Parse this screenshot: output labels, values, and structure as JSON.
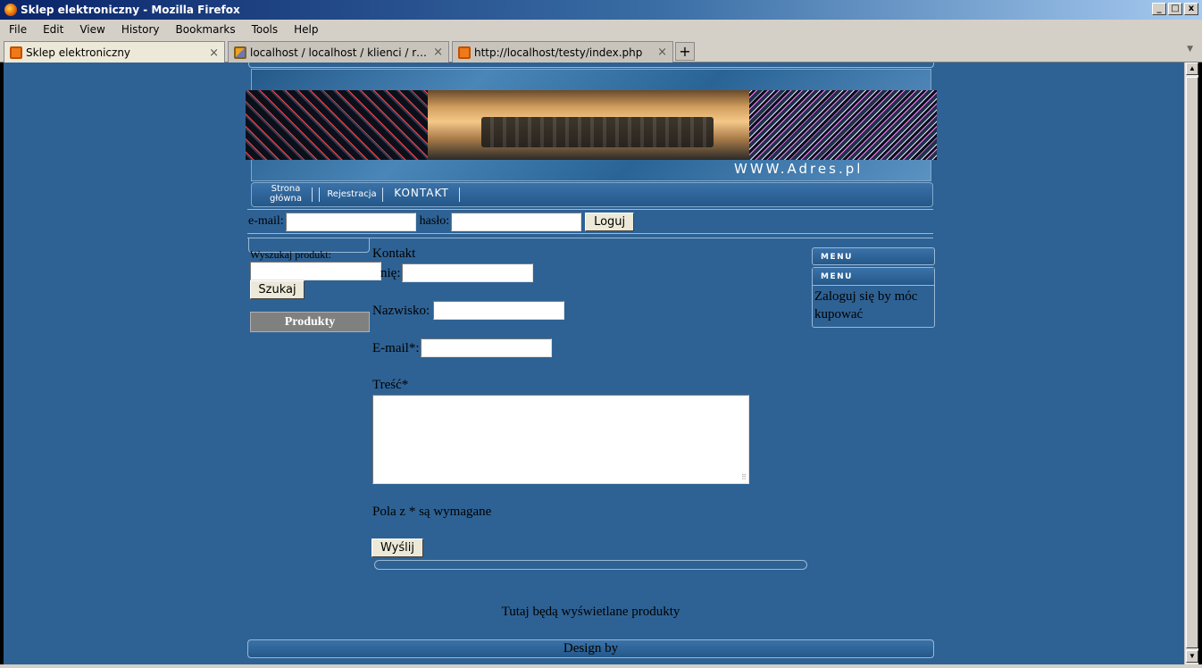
{
  "window": {
    "title": "Sklep elektroniczny - Mozilla Firefox",
    "btn_min": "_",
    "btn_max": "□",
    "btn_close": "x"
  },
  "menu": [
    "File",
    "Edit",
    "View",
    "History",
    "Bookmarks",
    "Tools",
    "Help"
  ],
  "tabs": [
    {
      "title": "Sklep elektroniczny",
      "close": "×"
    },
    {
      "title": "localhost / localhost / klienci / rejestracja ...",
      "close": "×"
    },
    {
      "title": "http://localhost/testy/index.php",
      "close": "×"
    }
  ],
  "newtab": "+",
  "site": {
    "url_banner": "WWW.Adres.pl",
    "nav": {
      "home_line1": "Strona",
      "home_line2": "główna",
      "register": "Rejestracja",
      "contact": "KONTAKT"
    },
    "login": {
      "email_label": "e-mail:",
      "password_label": "hasło:",
      "button": "Loguj",
      "email_value": "",
      "password_value": ""
    },
    "sidebar": {
      "search_label": "Wyszukaj produkt:",
      "search_value": "",
      "search_button": "Szukaj",
      "products": "Produkty"
    },
    "contact": {
      "heading": "Kontakt",
      "name_label": "nię:",
      "surname_label": "Nazwisko:",
      "email_label": "E-mail*:",
      "message_label": "Treść*",
      "required_note": "Pola z * są wymagane",
      "send_button": "Wyślij"
    },
    "right_menu": {
      "menu1": "MENU",
      "menu2": "MENU",
      "login_prompt": "Zaloguj się by móc kupować"
    },
    "products_placeholder": "Tutaj będą wyświetlane produkty",
    "footer": "Design by"
  }
}
